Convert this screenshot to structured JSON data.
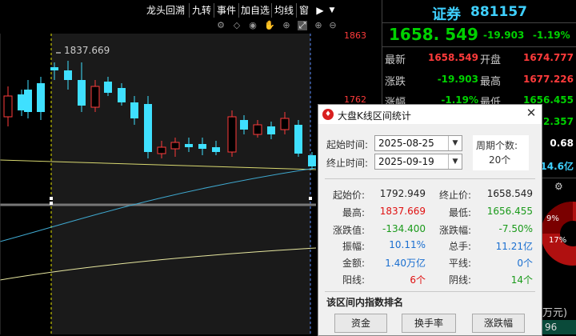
{
  "toolbar": {
    "items": [
      "龙头回溯",
      "九转",
      "事件",
      "加自选",
      "均线",
      "窗"
    ],
    "icons": [
      "settings-icon",
      "diamond-icon",
      "eye-icon",
      "hand-icon",
      "compass-icon",
      "expand-icon",
      "zoom-in-icon",
      "zoom-out-icon"
    ]
  },
  "chart": {
    "high_marker": "1837.669",
    "y_labels": [
      "1863",
      "1762"
    ]
  },
  "quote": {
    "name": "证券",
    "code": "881157",
    "price": "1658. 549",
    "change": "-19.903",
    "change_pct": "-1.19%",
    "rows": [
      {
        "label": "最新",
        "value": "1658.549",
        "label2": "开盘",
        "value2": "1674.777"
      },
      {
        "label": "涨跌",
        "value": "-19.903",
        "label2": "最高",
        "value2": "1677.226"
      },
      {
        "label": "涨幅",
        "value": "-1.19%",
        "label2": "最低",
        "value2": "1656.455"
      }
    ],
    "side_values": [
      "2.357",
      "0.68",
      "14.6亿"
    ],
    "pie_labels": [
      "9%",
      "17%"
    ],
    "bottom_text": "万元)",
    "bottom_value": "96"
  },
  "dialog": {
    "title": "大盘K线区间统计",
    "start_label": "起始时间:",
    "start_date": "2025-08-25",
    "end_label": "终止时间:",
    "end_date": "2025-09-19",
    "period_label": "周期个数:",
    "period_count": "20个",
    "stats": [
      {
        "l1": "起始价:",
        "v1": "1792.949",
        "c1": "sdark",
        "l2": "终止价:",
        "v2": "1658.549",
        "c2": "sdark"
      },
      {
        "l1": "最高:",
        "v1": "1837.669",
        "c1": "sred",
        "l2": "最低:",
        "v2": "1656.455",
        "c2": "sgreen"
      },
      {
        "l1": "涨跌值:",
        "v1": "-134.400",
        "c1": "sgreen",
        "l2": "涨跌幅:",
        "v2": "-7.50%",
        "c2": "sgreen"
      },
      {
        "l1": "振幅:",
        "v1": "10.11%",
        "c1": "sblue",
        "l2": "总手:",
        "v2": "11.21亿",
        "c2": "sblue"
      },
      {
        "l1": "金额:",
        "v1": "1.40万亿",
        "c1": "sblue",
        "l2": "平线:",
        "v2": "0个",
        "c2": "sblue"
      },
      {
        "l1": "阳线:",
        "v1": "6个",
        "c1": "sred",
        "l2": "阴线:",
        "v2": "14个",
        "c2": "sgreen"
      }
    ],
    "ranking_label": "该区间内指数排名",
    "buttons": [
      "资金",
      "换手率",
      "涨跌幅"
    ]
  }
}
